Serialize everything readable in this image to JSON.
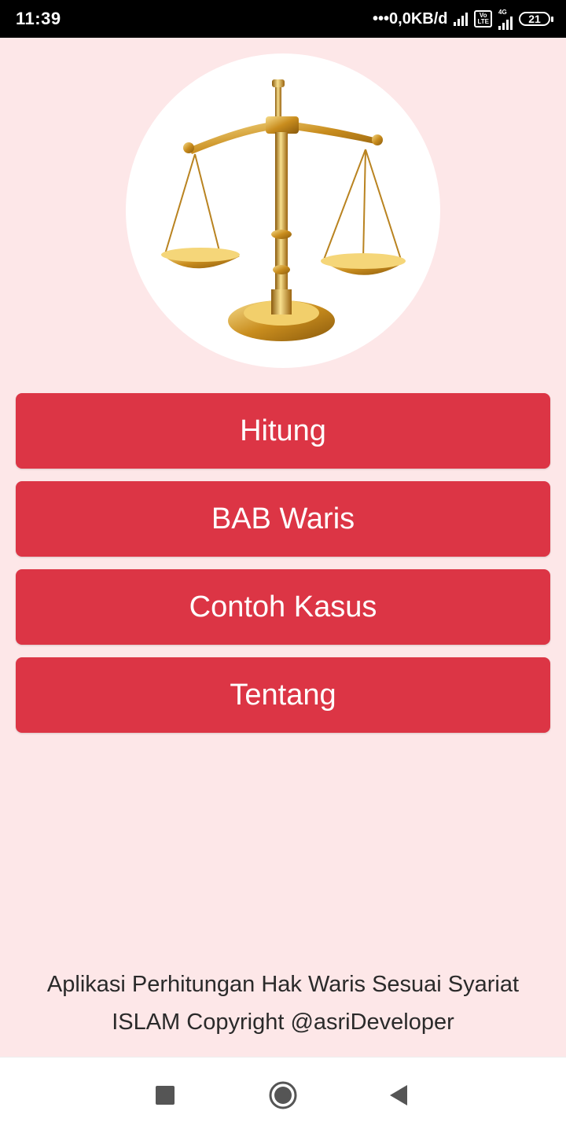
{
  "status_bar": {
    "time": "11:39",
    "network_speed": "•••0,0KB/d",
    "volte_line1": "Vo",
    "volte_line2": "LTE",
    "network_type": "4G",
    "battery": "21"
  },
  "logo": {
    "icon": "scales-of-justice-icon"
  },
  "menu": {
    "buttons": [
      {
        "label": "Hitung"
      },
      {
        "label": "BAB Waris"
      },
      {
        "label": "Contoh Kasus"
      },
      {
        "label": "Tentang"
      }
    ]
  },
  "footer": {
    "line1": "Aplikasi Perhitungan Hak Waris Sesuai Syariat",
    "line2": "ISLAM Copyright @asriDeveloper"
  },
  "nav_bar": {
    "icons": [
      "recents-icon",
      "home-icon",
      "back-icon"
    ]
  },
  "colors": {
    "background": "#fde7e8",
    "button": "#dc3545",
    "button_text": "#ffffff",
    "gold": "#d9a53a"
  }
}
